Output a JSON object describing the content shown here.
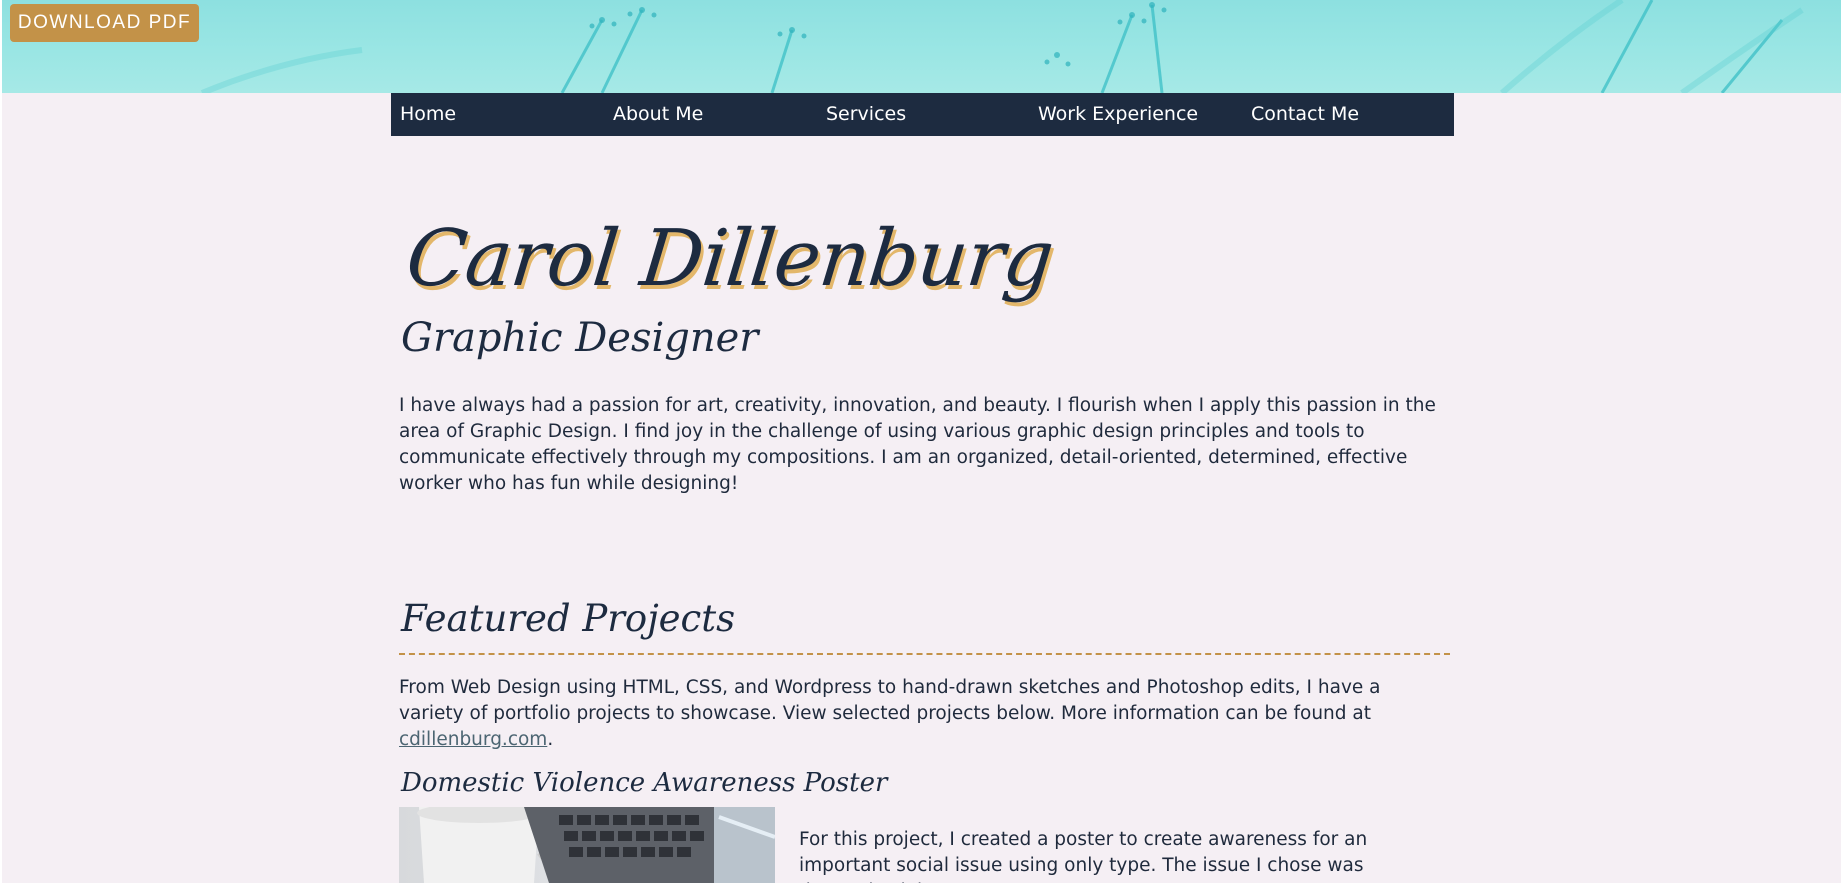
{
  "toolbar": {
    "download_label": "DOWNLOAD PDF"
  },
  "nav": {
    "items": [
      {
        "label": "Home"
      },
      {
        "label": "About Me"
      },
      {
        "label": "Services"
      },
      {
        "label": "Work Experience"
      },
      {
        "label": "Contact Me"
      }
    ]
  },
  "hero": {
    "name": "Carol Dillenburg",
    "subtitle": "Graphic Designer",
    "intro": "I have always had a passion for art, creativity, innovation, and beauty. I flourish when I apply this passion in the area of Graphic Design. I find joy in the challenge of using various graphic design principles and tools to communicate effectively through my compositions. I am an organized, detail-oriented, determined, effective worker who has fun while designing!"
  },
  "featured": {
    "title": "Featured Projects",
    "intro_text": "From Web Design using HTML, CSS, and Wordpress to hand-drawn sketches and Photoshop edits, I have a variety of portfolio projects to showcase. View selected projects below. More information can be found at ",
    "link_text": "cdillenburg.com",
    "intro_end": ".",
    "projects": [
      {
        "title": "Domestic Violence Awareness Poster",
        "description": "For this project, I created a poster to create awareness for an important social issue using only type. The issue I chose was domestic violence."
      }
    ]
  },
  "colors": {
    "navy": "#1d2b40",
    "gold": "#c39248",
    "banner": "#9ae6e4",
    "background": "#f5eff4",
    "link": "#4c6572"
  }
}
